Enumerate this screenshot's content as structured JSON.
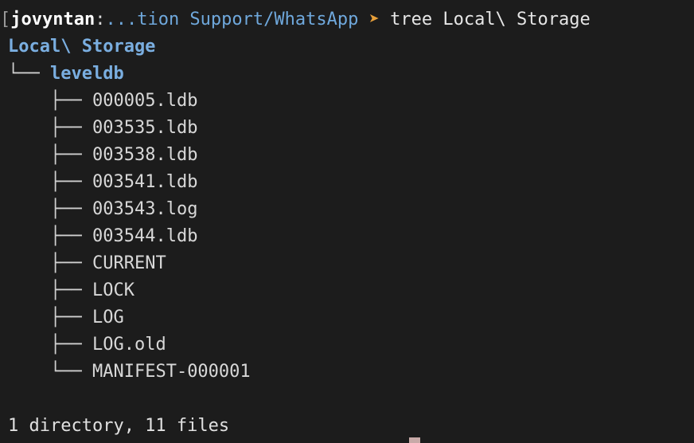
{
  "prompt": {
    "user": "jovyntan",
    "colon": ":",
    "path": "...tion Support/WhatsApp",
    "arrow": "➤",
    "command": "tree Local\\ Storage"
  },
  "tree": {
    "root": "Local\\ Storage",
    "level1_branch": "└──",
    "level1_dir": "leveldb",
    "items": [
      {
        "branch": "├──",
        "name": "000005.ldb"
      },
      {
        "branch": "├──",
        "name": "003535.ldb"
      },
      {
        "branch": "├──",
        "name": "003538.ldb"
      },
      {
        "branch": "├──",
        "name": "003541.ldb"
      },
      {
        "branch": "├──",
        "name": "003543.log"
      },
      {
        "branch": "├──",
        "name": "003544.ldb"
      },
      {
        "branch": "├──",
        "name": "CURRENT"
      },
      {
        "branch": "├──",
        "name": "LOCK"
      },
      {
        "branch": "├──",
        "name": "LOG"
      },
      {
        "branch": "├──",
        "name": "LOG.old"
      },
      {
        "branch": "└──",
        "name": "MANIFEST-000001"
      }
    ]
  },
  "summary": "1 directory, 11 files",
  "colors": {
    "background": "#1c1c1c",
    "directory": "#7aaee0",
    "prompt_arrow": "#e8a03a",
    "cursor": "#c8aaa8"
  }
}
